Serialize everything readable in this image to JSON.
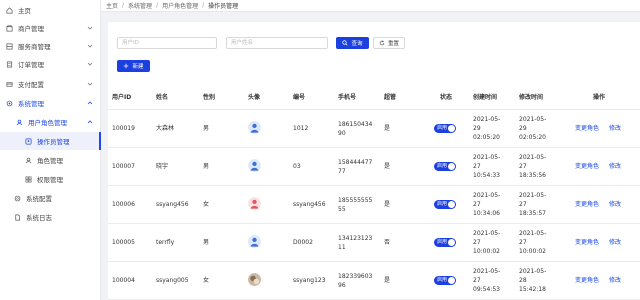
{
  "sidebar": {
    "items": [
      {
        "label": "主页",
        "icon": "home-icon"
      },
      {
        "label": "商户管理",
        "icon": "shop-icon"
      },
      {
        "label": "服务商管理",
        "icon": "provider-icon"
      },
      {
        "label": "订单管理",
        "icon": "order-icon"
      },
      {
        "label": "支付配置",
        "icon": "payment-icon"
      },
      {
        "label": "系统管理",
        "icon": "settings-icon"
      },
      {
        "label": "用户角色管理",
        "icon": "user-role-icon"
      },
      {
        "label": "操作员管理",
        "icon": "operator-icon"
      },
      {
        "label": "角色管理",
        "icon": "role-icon"
      },
      {
        "label": "权限管理",
        "icon": "permission-icon"
      },
      {
        "label": "系统配置",
        "icon": "config-icon"
      },
      {
        "label": "系统日志",
        "icon": "log-icon"
      }
    ]
  },
  "breadcrumb": [
    "主页",
    "系统管理",
    "用户角色管理",
    "操作员管理"
  ],
  "search": {
    "user_id_placeholder": "用户ID",
    "user_name_placeholder": "用户姓名",
    "search_label": "查询",
    "reset_label": "重置",
    "add_label": "新建"
  },
  "table": {
    "headers": [
      "用户ID",
      "姓名",
      "性别",
      "头像",
      "编号",
      "手机号",
      "超管",
      "状态",
      "创建时间",
      "修改时间",
      "操作"
    ],
    "action_labels": {
      "change_role": "变更角色",
      "edit": "修改"
    },
    "rows": [
      {
        "id": "100019",
        "name": "大森林",
        "gender": "男",
        "avatar": "male",
        "code": "1012",
        "phone": [
          "186150434",
          "90"
        ],
        "admin": "是",
        "status": "启用",
        "created": [
          "2021-05-",
          "29",
          "02:05:20"
        ],
        "updated": [
          "2021-05-",
          "29",
          "02:05:20"
        ]
      },
      {
        "id": "100007",
        "name": "晓宇",
        "gender": "男",
        "avatar": "male",
        "code": "03",
        "phone": [
          "158444477",
          "77"
        ],
        "admin": "是",
        "status": "启用",
        "created": [
          "2021-05-",
          "27",
          "10:54:33"
        ],
        "updated": [
          "2021-05-",
          "27",
          "18:35:56"
        ]
      },
      {
        "id": "100006",
        "name": "ssyang456",
        "gender": "女",
        "avatar": "female",
        "code": "ssyang456",
        "phone": [
          "185555555",
          "55"
        ],
        "admin": "是",
        "status": "启用",
        "created": [
          "2021-05-",
          "27",
          "10:34:06"
        ],
        "updated": [
          "2021-05-",
          "27",
          "18:35:57"
        ]
      },
      {
        "id": "100005",
        "name": "terrfly",
        "gender": "男",
        "avatar": "male",
        "code": "D0002",
        "phone": [
          "134123123",
          "11"
        ],
        "admin": "否",
        "status": "启用",
        "created": [
          "2021-05-",
          "27",
          "10:00:02"
        ],
        "updated": [
          "2021-05-",
          "27",
          "10:00:02"
        ]
      },
      {
        "id": "100004",
        "name": "ssyang005",
        "gender": "女",
        "avatar": "photo",
        "code": "ssyang123",
        "phone": [
          "182339603",
          "96"
        ],
        "admin": "是",
        "status": "启用",
        "created": [
          "2021-05-",
          "27",
          "09:54:53"
        ],
        "updated": [
          "2021-05-",
          "28",
          "15:42:18"
        ]
      }
    ]
  },
  "colors": {
    "accent": "#1c3fe0",
    "active_menu_bg": "#eef0fc"
  }
}
